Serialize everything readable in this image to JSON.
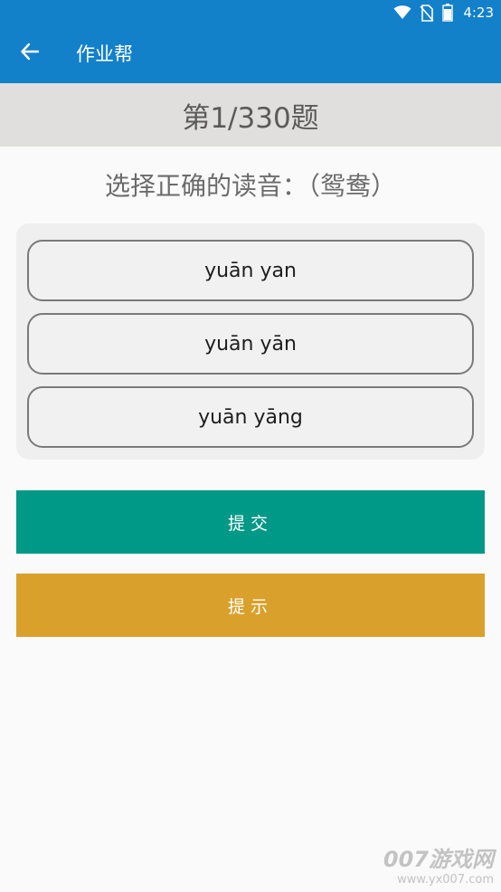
{
  "status_bar": {
    "time": "4:23",
    "icons": [
      "wifi-icon",
      "no-sim-icon",
      "battery-icon"
    ]
  },
  "app_bar": {
    "back_icon": "arrow-left-icon",
    "title": "作业帮"
  },
  "quiz": {
    "counter": "第1/330题",
    "question": "选择正确的读音：（鸳鸯）",
    "options": [
      "yuān yan",
      "yuān yān",
      "yuān yāng"
    ]
  },
  "actions": {
    "submit_label": "提交",
    "hint_label": "提示"
  },
  "watermark": {
    "main": "007游戏网",
    "url": "www.yx007.com"
  },
  "colors": {
    "app_bar": "#1380ca",
    "counter_banner": "#e0dfdd",
    "submit": "#009886",
    "hint": "#d9a02c"
  }
}
